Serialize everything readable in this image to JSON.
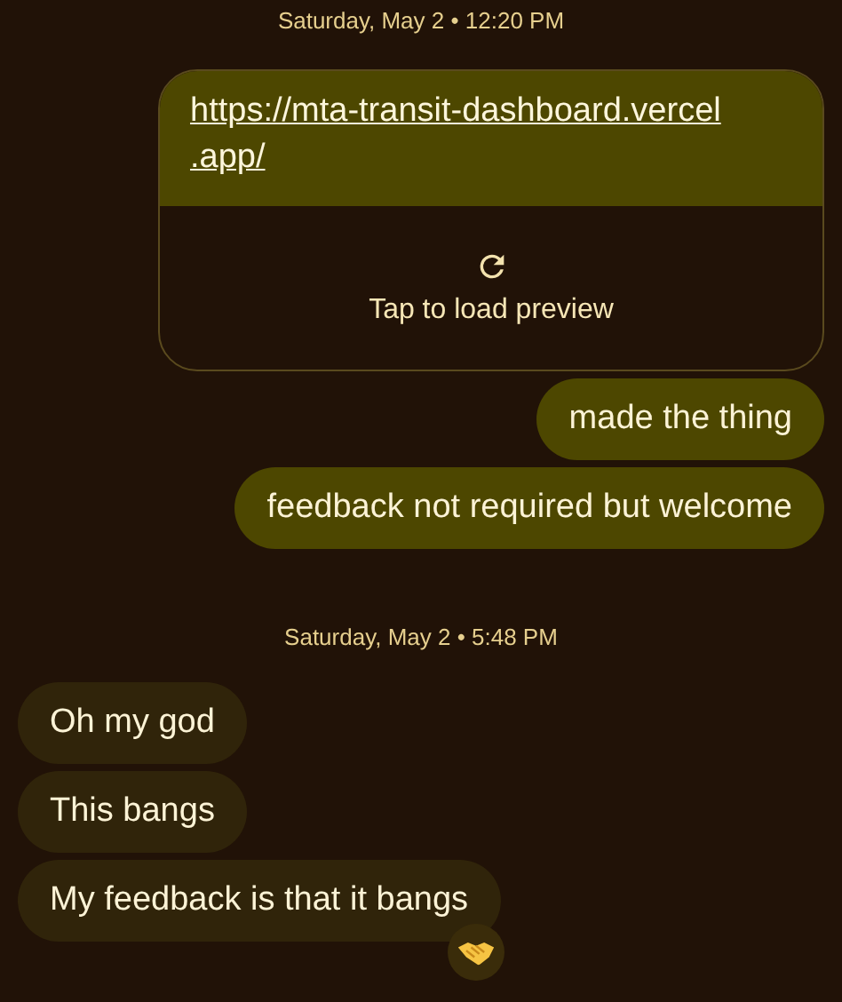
{
  "items": [
    {
      "kind": "timestamp",
      "text": "Saturday, May 2 • 12:20 PM"
    },
    {
      "kind": "sent_link",
      "url": "https://mta-transit-dashboard.vercel\n.app/",
      "action": "Tap to load preview"
    },
    {
      "kind": "sent",
      "text": "made the thing"
    },
    {
      "kind": "sent",
      "text": "feedback not required but welcome"
    },
    {
      "kind": "timestamp",
      "text": "Saturday, May 2 • 5:48 PM"
    },
    {
      "kind": "received",
      "text": "Oh my god"
    },
    {
      "kind": "received",
      "text": "This bangs"
    },
    {
      "kind": "received",
      "text": "My feedback is that it bangs",
      "reaction": true
    }
  ]
}
